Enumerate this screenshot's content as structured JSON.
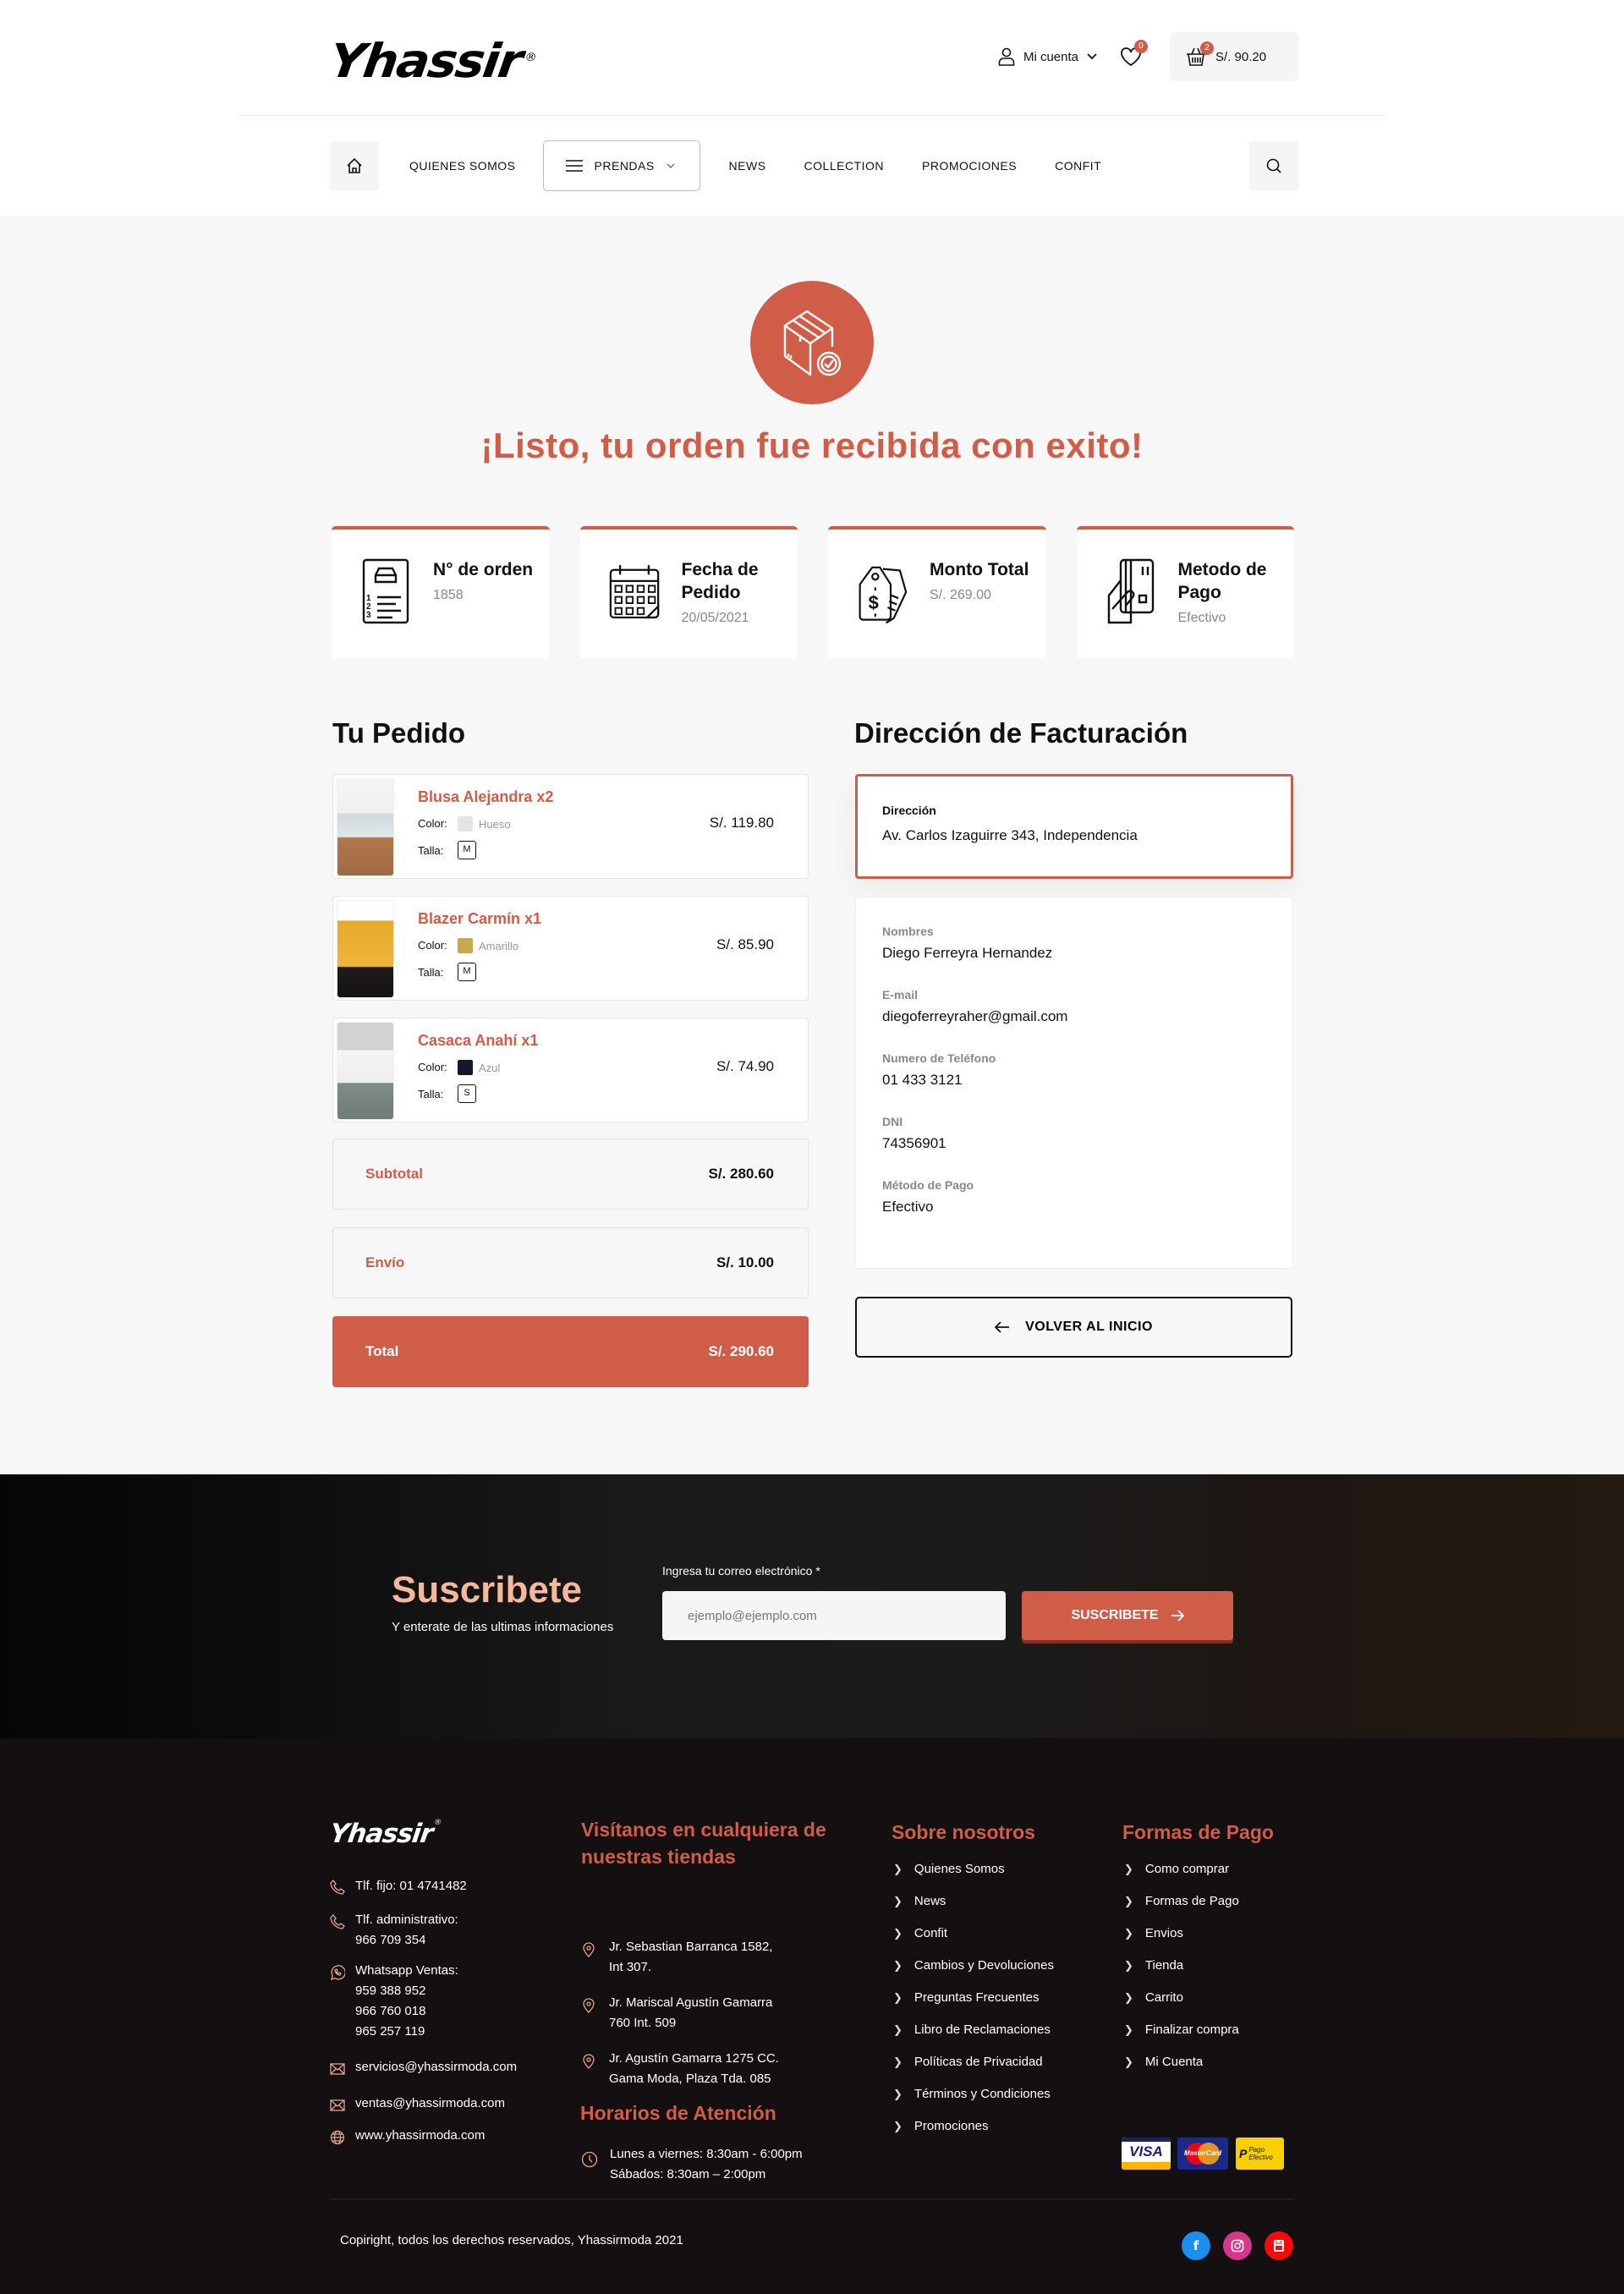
{
  "header": {
    "logo": "Yhassir",
    "logo_mark": "®",
    "account_label": "Mi cuenta",
    "wishlist_count": "0",
    "cart_count": "2",
    "cart_total": "S/. 90.20"
  },
  "nav": {
    "items": [
      "QUIENES SOMOS",
      "PRENDAS",
      "NEWS",
      "COLLECTION",
      "PROMOCIONES",
      "CONFIT"
    ]
  },
  "hero": {
    "title": "¡Listo, tu orden fue recibida con exito!"
  },
  "summary_cards": [
    {
      "title": "N° de orden",
      "value": "1858",
      "icon": "order-list-icon"
    },
    {
      "title": "Fecha de Pedido",
      "value": "20/05/2021",
      "icon": "calendar-icon"
    },
    {
      "title": "Monto Total",
      "value": "S/. 269.00",
      "icon": "price-tag-icon"
    },
    {
      "title": "Metodo de Pago",
      "value": "Efectivo",
      "icon": "card-hand-icon"
    }
  ],
  "order": {
    "heading": "Tu Pedido",
    "color_label": "Color:",
    "size_label": "Talla:",
    "items": [
      {
        "name": "Blusa Alejandra x2",
        "color": "Hueso",
        "color_hex": "#e6e3e1",
        "size": "M",
        "price": "S/. 119.80"
      },
      {
        "name": "Blazer Carmín x1",
        "color": "Amarillo",
        "color_hex": "#c9a94a",
        "size": "M",
        "price": "S/. 85.90"
      },
      {
        "name": "Casaca Anahí  x1",
        "color": "Azul",
        "color_hex": "#15172b",
        "size": "S",
        "price": "S/. 74.90"
      }
    ],
    "subtotal_label": "Subtotal",
    "subtotal": "S/. 280.60",
    "shipping_label": "Envío",
    "shipping": "S/. 10.00",
    "total_label": "Total",
    "total": "S/. 290.60"
  },
  "billing": {
    "heading": "Dirección de Facturación",
    "address_label": "Dirección",
    "address": "Av. Carlos Izaguirre 343, Independencia",
    "fields": [
      {
        "label": "Nombres",
        "value": "Diego Ferreyra Hernandez"
      },
      {
        "label": "E-mail",
        "value": "diegoferreyraher@gmail.com"
      },
      {
        "label": "Numero de Teléfono",
        "value": "01 433 3121"
      },
      {
        "label": "DNI",
        "value": "74356901"
      },
      {
        "label": "Método de Pago",
        "value": "Efectivo"
      }
    ],
    "back_button": "VOLVER AL INICIO"
  },
  "subscribe": {
    "title": "Suscribete",
    "subtitle": "Y enterate de las ultimas informaciones",
    "field_label": "Ingresa tu correo electrónico *",
    "placeholder": "ejemplo@ejemplo.com",
    "button": "SUSCRIBETE"
  },
  "footer": {
    "logo": "Yhassir",
    "contact": {
      "phone_fixed": "Tlf. fijo: 01 4741482",
      "phone_admin_label": "Tlf. administrativo:",
      "phone_admin": "966 709 354",
      "whatsapp_label": "Whatsapp Ventas:",
      "whatsapp_numbers": [
        "959 388 952",
        "966 760 018",
        "965 257 119"
      ],
      "email_services": "servicios@yhassirmoda.com",
      "email_sales": "ventas@yhassirmoda.com",
      "website": "www.yhassirmoda.com"
    },
    "stores_heading": "Visítanos en cualquiera de nuestras tiendas",
    "stores": [
      [
        "Jr. Sebastian Barranca 1582,",
        "Int 307."
      ],
      [
        "Jr. Mariscal Agustín Gamarra",
        "760 Int. 509"
      ],
      [
        "Jr. Agustín Gamarra 1275 CC.",
        "Gama Moda, Plaza Tda. 085"
      ]
    ],
    "hours_heading": "Horarios de Atención",
    "hours": [
      "Lunes a viernes: 8:30am - 6:00pm",
      "Sábados: 8:30am – 2:00pm"
    ],
    "about_heading": "Sobre nosotros",
    "about_links": [
      "Quienes Somos",
      "News",
      "Confit",
      "Cambios y Devoluciones",
      "Preguntas Frecuentes",
      "Libro de Reclamaciones",
      "Políticas de Privacidad",
      "Términos y Condiciones",
      "Promociones"
    ],
    "payments_heading": "Formas de Pago",
    "payment_links": [
      "Como comprar",
      "Formas de Pago",
      "Envios",
      "Tienda",
      "Carrito",
      "Finalizar compra",
      "Mi Cuenta"
    ],
    "payment_logos": [
      "VISA",
      "MasterCard",
      "Pago Efectivo"
    ],
    "copyright": "Copiright, todos los derechos reservados, Yhassirmoda 2021",
    "social": [
      "facebook",
      "instagram",
      "youtube"
    ]
  },
  "colors": {
    "accent": "#d05d47",
    "subscribe_title": "#f6b89d",
    "footer_bg": "#141011",
    "page_bg": "#f7f7f7"
  }
}
